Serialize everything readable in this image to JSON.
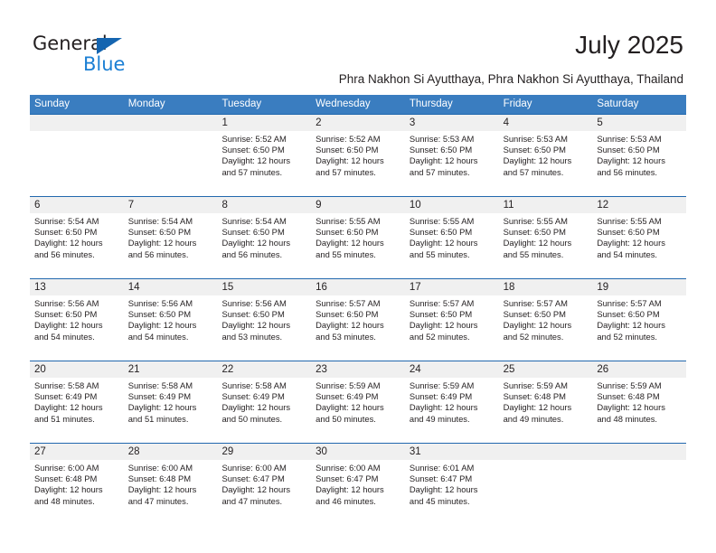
{
  "brand": {
    "name_part1": "General",
    "name_part2": "Blue",
    "accent_color": "#1b7fd4",
    "triangle_color": "#1565b0"
  },
  "header": {
    "title": "July 2025",
    "location": "Phra Nakhon Si Ayutthaya, Phra Nakhon Si Ayutthaya, Thailand"
  },
  "calendar": {
    "header_bg": "#3a7dc0",
    "row_border_color": "#2168ae",
    "daynum_band_bg": "#f0f0f0",
    "day_names": [
      "Sunday",
      "Monday",
      "Tuesday",
      "Wednesday",
      "Thursday",
      "Friday",
      "Saturday"
    ],
    "weeks": [
      [
        {
          "day": "",
          "sunrise": "",
          "sunset": "",
          "daylight1": "",
          "daylight2": ""
        },
        {
          "day": "",
          "sunrise": "",
          "sunset": "",
          "daylight1": "",
          "daylight2": ""
        },
        {
          "day": "1",
          "sunrise": "Sunrise: 5:52 AM",
          "sunset": "Sunset: 6:50 PM",
          "daylight1": "Daylight: 12 hours",
          "daylight2": "and 57 minutes."
        },
        {
          "day": "2",
          "sunrise": "Sunrise: 5:52 AM",
          "sunset": "Sunset: 6:50 PM",
          "daylight1": "Daylight: 12 hours",
          "daylight2": "and 57 minutes."
        },
        {
          "day": "3",
          "sunrise": "Sunrise: 5:53 AM",
          "sunset": "Sunset: 6:50 PM",
          "daylight1": "Daylight: 12 hours",
          "daylight2": "and 57 minutes."
        },
        {
          "day": "4",
          "sunrise": "Sunrise: 5:53 AM",
          "sunset": "Sunset: 6:50 PM",
          "daylight1": "Daylight: 12 hours",
          "daylight2": "and 57 minutes."
        },
        {
          "day": "5",
          "sunrise": "Sunrise: 5:53 AM",
          "sunset": "Sunset: 6:50 PM",
          "daylight1": "Daylight: 12 hours",
          "daylight2": "and 56 minutes."
        }
      ],
      [
        {
          "day": "6",
          "sunrise": "Sunrise: 5:54 AM",
          "sunset": "Sunset: 6:50 PM",
          "daylight1": "Daylight: 12 hours",
          "daylight2": "and 56 minutes."
        },
        {
          "day": "7",
          "sunrise": "Sunrise: 5:54 AM",
          "sunset": "Sunset: 6:50 PM",
          "daylight1": "Daylight: 12 hours",
          "daylight2": "and 56 minutes."
        },
        {
          "day": "8",
          "sunrise": "Sunrise: 5:54 AM",
          "sunset": "Sunset: 6:50 PM",
          "daylight1": "Daylight: 12 hours",
          "daylight2": "and 56 minutes."
        },
        {
          "day": "9",
          "sunrise": "Sunrise: 5:55 AM",
          "sunset": "Sunset: 6:50 PM",
          "daylight1": "Daylight: 12 hours",
          "daylight2": "and 55 minutes."
        },
        {
          "day": "10",
          "sunrise": "Sunrise: 5:55 AM",
          "sunset": "Sunset: 6:50 PM",
          "daylight1": "Daylight: 12 hours",
          "daylight2": "and 55 minutes."
        },
        {
          "day": "11",
          "sunrise": "Sunrise: 5:55 AM",
          "sunset": "Sunset: 6:50 PM",
          "daylight1": "Daylight: 12 hours",
          "daylight2": "and 55 minutes."
        },
        {
          "day": "12",
          "sunrise": "Sunrise: 5:55 AM",
          "sunset": "Sunset: 6:50 PM",
          "daylight1": "Daylight: 12 hours",
          "daylight2": "and 54 minutes."
        }
      ],
      [
        {
          "day": "13",
          "sunrise": "Sunrise: 5:56 AM",
          "sunset": "Sunset: 6:50 PM",
          "daylight1": "Daylight: 12 hours",
          "daylight2": "and 54 minutes."
        },
        {
          "day": "14",
          "sunrise": "Sunrise: 5:56 AM",
          "sunset": "Sunset: 6:50 PM",
          "daylight1": "Daylight: 12 hours",
          "daylight2": "and 54 minutes."
        },
        {
          "day": "15",
          "sunrise": "Sunrise: 5:56 AM",
          "sunset": "Sunset: 6:50 PM",
          "daylight1": "Daylight: 12 hours",
          "daylight2": "and 53 minutes."
        },
        {
          "day": "16",
          "sunrise": "Sunrise: 5:57 AM",
          "sunset": "Sunset: 6:50 PM",
          "daylight1": "Daylight: 12 hours",
          "daylight2": "and 53 minutes."
        },
        {
          "day": "17",
          "sunrise": "Sunrise: 5:57 AM",
          "sunset": "Sunset: 6:50 PM",
          "daylight1": "Daylight: 12 hours",
          "daylight2": "and 52 minutes."
        },
        {
          "day": "18",
          "sunrise": "Sunrise: 5:57 AM",
          "sunset": "Sunset: 6:50 PM",
          "daylight1": "Daylight: 12 hours",
          "daylight2": "and 52 minutes."
        },
        {
          "day": "19",
          "sunrise": "Sunrise: 5:57 AM",
          "sunset": "Sunset: 6:50 PM",
          "daylight1": "Daylight: 12 hours",
          "daylight2": "and 52 minutes."
        }
      ],
      [
        {
          "day": "20",
          "sunrise": "Sunrise: 5:58 AM",
          "sunset": "Sunset: 6:49 PM",
          "daylight1": "Daylight: 12 hours",
          "daylight2": "and 51 minutes."
        },
        {
          "day": "21",
          "sunrise": "Sunrise: 5:58 AM",
          "sunset": "Sunset: 6:49 PM",
          "daylight1": "Daylight: 12 hours",
          "daylight2": "and 51 minutes."
        },
        {
          "day": "22",
          "sunrise": "Sunrise: 5:58 AM",
          "sunset": "Sunset: 6:49 PM",
          "daylight1": "Daylight: 12 hours",
          "daylight2": "and 50 minutes."
        },
        {
          "day": "23",
          "sunrise": "Sunrise: 5:59 AM",
          "sunset": "Sunset: 6:49 PM",
          "daylight1": "Daylight: 12 hours",
          "daylight2": "and 50 minutes."
        },
        {
          "day": "24",
          "sunrise": "Sunrise: 5:59 AM",
          "sunset": "Sunset: 6:49 PM",
          "daylight1": "Daylight: 12 hours",
          "daylight2": "and 49 minutes."
        },
        {
          "day": "25",
          "sunrise": "Sunrise: 5:59 AM",
          "sunset": "Sunset: 6:48 PM",
          "daylight1": "Daylight: 12 hours",
          "daylight2": "and 49 minutes."
        },
        {
          "day": "26",
          "sunrise": "Sunrise: 5:59 AM",
          "sunset": "Sunset: 6:48 PM",
          "daylight1": "Daylight: 12 hours",
          "daylight2": "and 48 minutes."
        }
      ],
      [
        {
          "day": "27",
          "sunrise": "Sunrise: 6:00 AM",
          "sunset": "Sunset: 6:48 PM",
          "daylight1": "Daylight: 12 hours",
          "daylight2": "and 48 minutes."
        },
        {
          "day": "28",
          "sunrise": "Sunrise: 6:00 AM",
          "sunset": "Sunset: 6:48 PM",
          "daylight1": "Daylight: 12 hours",
          "daylight2": "and 47 minutes."
        },
        {
          "day": "29",
          "sunrise": "Sunrise: 6:00 AM",
          "sunset": "Sunset: 6:47 PM",
          "daylight1": "Daylight: 12 hours",
          "daylight2": "and 47 minutes."
        },
        {
          "day": "30",
          "sunrise": "Sunrise: 6:00 AM",
          "sunset": "Sunset: 6:47 PM",
          "daylight1": "Daylight: 12 hours",
          "daylight2": "and 46 minutes."
        },
        {
          "day": "31",
          "sunrise": "Sunrise: 6:01 AM",
          "sunset": "Sunset: 6:47 PM",
          "daylight1": "Daylight: 12 hours",
          "daylight2": "and 45 minutes."
        },
        {
          "day": "",
          "sunrise": "",
          "sunset": "",
          "daylight1": "",
          "daylight2": ""
        },
        {
          "day": "",
          "sunrise": "",
          "sunset": "",
          "daylight1": "",
          "daylight2": ""
        }
      ]
    ]
  }
}
